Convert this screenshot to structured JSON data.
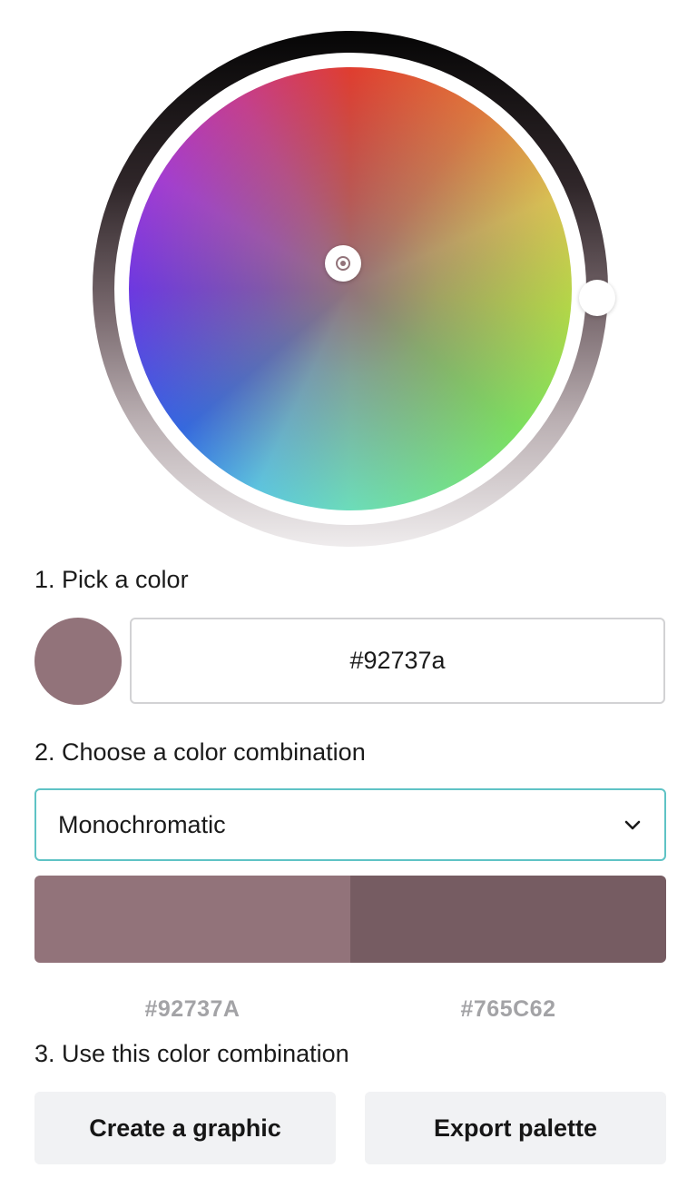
{
  "picker": {
    "selected_color": "#92737a",
    "value_ring_colors": {
      "top": "#060606",
      "bottom": "#efeced"
    },
    "hue_handle_icon": "target-icon"
  },
  "step1": {
    "title": "1. Pick a color",
    "hex_value": "#92737a"
  },
  "step2": {
    "title": "2. Choose a color combination",
    "combination": "Monochromatic",
    "dropdown_icon": "chevron-down-icon",
    "palette": [
      {
        "label": "#92737A",
        "color": "#92737a"
      },
      {
        "label": "#765C62",
        "color": "#765c62"
      }
    ]
  },
  "step3": {
    "title": "3. Use this color combination",
    "create_label": "Create a graphic",
    "export_label": "Export palette"
  },
  "colors": {
    "accent_border": "#5fc3c5",
    "button_bg": "#f1f2f4",
    "label_gray": "#a3a3a6"
  }
}
